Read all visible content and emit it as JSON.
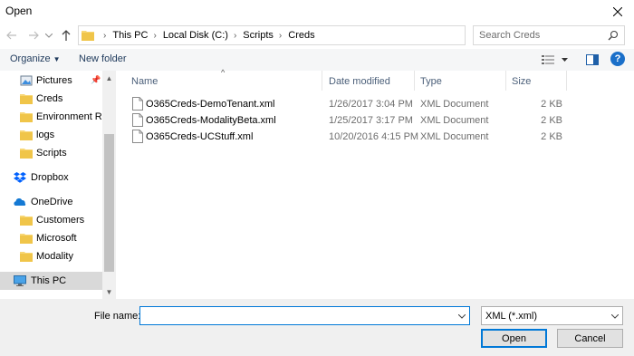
{
  "window": {
    "title": "Open"
  },
  "address": {
    "crumbs": [
      "This PC",
      "Local Disk (C:)",
      "Scripts",
      "Creds"
    ]
  },
  "search": {
    "placeholder": "Search Creds"
  },
  "toolbar": {
    "organize": "Organize",
    "new_folder": "New folder"
  },
  "nav": {
    "items": [
      {
        "label": "Pictures",
        "icon": "pictures-icon",
        "pinned": true
      },
      {
        "label": "Creds",
        "icon": "folder-icon"
      },
      {
        "label": "Environment Rep",
        "icon": "folder-icon"
      },
      {
        "label": "logs",
        "icon": "folder-icon"
      },
      {
        "label": "Scripts",
        "icon": "folder-icon"
      },
      {
        "label": "Dropbox",
        "icon": "dropbox-icon"
      },
      {
        "label": "OneDrive",
        "icon": "onedrive-icon"
      },
      {
        "label": "Customers",
        "icon": "folder-icon"
      },
      {
        "label": "Microsoft",
        "icon": "folder-icon"
      },
      {
        "label": "Modality",
        "icon": "folder-icon"
      },
      {
        "label": "This PC",
        "icon": "computer-icon",
        "selected": true
      }
    ]
  },
  "columns": {
    "name": "Name",
    "date": "Date modified",
    "type": "Type",
    "size": "Size"
  },
  "files": [
    {
      "name": "O365Creds-DemoTenant.xml",
      "date": "1/26/2017 3:04 PM",
      "type": "XML Document",
      "size": "2 KB"
    },
    {
      "name": "O365Creds-ModalityBeta.xml",
      "date": "1/25/2017 3:17 PM",
      "type": "XML Document",
      "size": "2 KB"
    },
    {
      "name": "O365Creds-UCStuff.xml",
      "date": "10/20/2016 4:15 PM",
      "type": "XML Document",
      "size": "2 KB"
    }
  ],
  "bottom": {
    "file_name_label": "File name:",
    "file_name_value": "",
    "file_type": "XML (*.xml)",
    "open": "Open",
    "cancel": "Cancel"
  },
  "colors": {
    "accent": "#0078d7",
    "folder": "#f8d775",
    "toolbar_text": "#1e395b"
  }
}
